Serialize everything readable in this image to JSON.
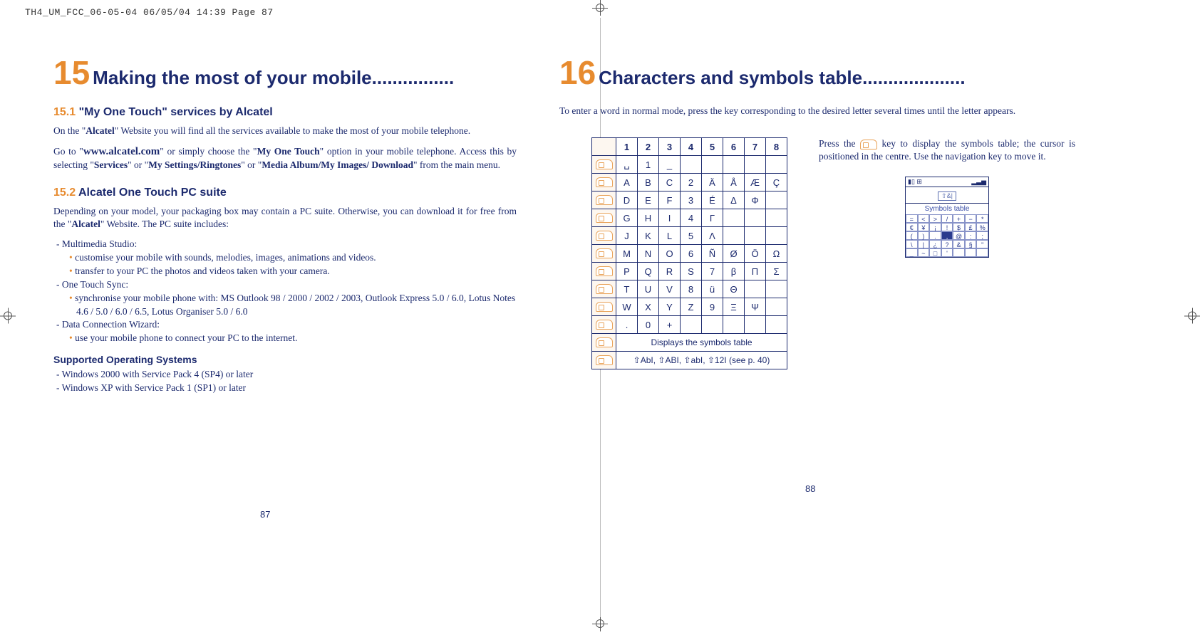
{
  "print_header": "TH4_UM_FCC_06-05-04  06/05/04  14:39  Page 87",
  "left": {
    "chapter_num": "15",
    "chapter_title": "Making the most of your mobile................",
    "sec1_num": "15.1",
    "sec1_title": "\"My One Touch\" services by Alcatel",
    "p1a": "On the \"",
    "p1b": "Alcatel",
    "p1c": "\" Website you will find all the services available to make the most of your mobile telephone.",
    "p2a": "Go to \"",
    "p2b": "www.alcatel.com",
    "p2c": "\" or simply choose the \"",
    "p2d": "My One Touch",
    "p2e": "\" option in your mobile telephone. Access this by selecting \"",
    "p2f": "Services",
    "p2g": "\" or \"",
    "p2h": "My Settings/Ringtones",
    "p2i": "\" or \"",
    "p2j": "Media Album/My Images/ Download",
    "p2k": "\" from the main menu.",
    "sec2_num": "15.2",
    "sec2_title": "Alcatel One Touch PC suite",
    "p3a": "Depending on your model, your packaging box may contain a PC suite. Otherwise, you can download it for free from the \"",
    "p3b": "Alcatel",
    "p3c": "\" Website. The PC suite includes:",
    "li1": "-  Multimedia Studio:",
    "li1a": "customise your mobile with sounds, melodies, images, animations and videos.",
    "li1b": "transfer to your PC the photos and videos taken with your camera.",
    "li2": "-  One Touch Sync:",
    "li2a": "synchronise your mobile phone with: MS Outlook 98 / 2000 / 2002 / 2003, Outlook Express 5.0 / 6.0, Lotus Notes 4.6 / 5.0 / 6.0 / 6.5, Lotus Organiser 5.0 / 6.0",
    "li3": "-  Data Connection Wizard:",
    "li3a": "use your mobile phone to connect your PC to the internet.",
    "os_head": "Supported Operating Systems",
    "os1": "-  Windows 2000 with Service Pack 4 (SP4) or later",
    "os2": "-  Windows XP with Service Pack 1 (SP1) or later",
    "folio": "87"
  },
  "right": {
    "chapter_num": "16",
    "chapter_title": "Characters and symbols table....................",
    "intro": "To enter a word in normal mode, press the key corresponding to the desired letter several times until the letter appears.",
    "side_a": "Press the ",
    "side_b": " key to display the symbols table; the cursor is positioned in the centre. Use the navigation key to move it.",
    "phone_title": "Symbols table",
    "phone_input": "⇧&|",
    "folio": "88"
  },
  "table": {
    "header": [
      "",
      "1",
      "2",
      "3",
      "4",
      "5",
      "6",
      "7",
      "8"
    ],
    "rows": [
      [
        "␣",
        "1",
        "_",
        "",
        "",
        "",
        "",
        ""
      ],
      [
        "A",
        "B",
        "C",
        "2",
        "Ä",
        "Å",
        "Æ",
        "Ç"
      ],
      [
        "D",
        "E",
        "F",
        "3",
        "É",
        "Δ",
        "Φ",
        ""
      ],
      [
        "G",
        "H",
        "I",
        "4",
        "Γ",
        "",
        "",
        ""
      ],
      [
        "J",
        "K",
        "L",
        "5",
        "Λ",
        "",
        "",
        ""
      ],
      [
        "M",
        "N",
        "O",
        "6",
        "Ñ",
        "Ø",
        "Ö",
        "Ω"
      ],
      [
        "P",
        "Q",
        "R",
        "S",
        "7",
        "β",
        "Π",
        "Σ"
      ],
      [
        "T",
        "U",
        "V",
        "8",
        "ü",
        "Θ",
        "",
        ""
      ],
      [
        "W",
        "X",
        "Y",
        "Z",
        "9",
        "Ξ",
        "Ψ",
        ""
      ],
      [
        ".",
        "0",
        "+",
        "",
        "",
        "",
        "",
        ""
      ]
    ],
    "star_row": "Displays the symbols table",
    "hash_row": "⇧AbI, ⇧ABI, ⇧abI, ⇧12I (see p. 40)"
  },
  "symbols_grid": [
    [
      "=",
      "<",
      ">",
      "/",
      "+",
      "−",
      "*"
    ],
    [
      "€",
      "¥",
      "¡",
      "!",
      "$",
      "£",
      "%"
    ],
    [
      "(",
      ")",
      ".",
      ",",
      "@",
      ":",
      ";"
    ],
    [
      "\\",
      "|",
      "¿",
      "?",
      "&",
      "§",
      "\""
    ],
    [
      "_",
      "~",
      "□",
      "'",
      " ",
      " ",
      " "
    ]
  ]
}
